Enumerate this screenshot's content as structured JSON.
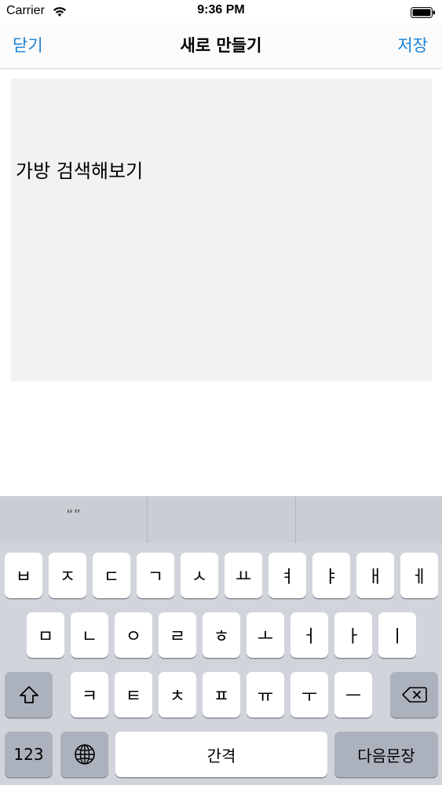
{
  "status_bar": {
    "carrier": "Carrier",
    "time": "9:36 PM"
  },
  "nav": {
    "close_label": "닫기",
    "title": "새로 만들기",
    "save_label": "저장"
  },
  "editor": {
    "text": "가방 검색해보기"
  },
  "keyboard": {
    "suggestions": [
      "“”",
      "",
      ""
    ],
    "row1": [
      "ㅂ",
      "ㅈ",
      "ㄷ",
      "ㄱ",
      "ㅅ",
      "ㅛ",
      "ㅕ",
      "ㅑ",
      "ㅐ",
      "ㅔ"
    ],
    "row2": [
      "ㅁ",
      "ㄴ",
      "ㅇ",
      "ㄹ",
      "ㅎ",
      "ㅗ",
      "ㅓ",
      "ㅏ",
      "ㅣ"
    ],
    "row3": [
      "ㅋ",
      "ㅌ",
      "ㅊ",
      "ㅍ",
      "ㅠ",
      "ㅜ",
      "ㅡ"
    ],
    "numbers_label": "123",
    "space_label": "간격",
    "return_label": "다음문장"
  },
  "icons": {
    "wifi": "wifi-icon",
    "battery": "battery-icon",
    "shift": "shift-icon",
    "delete": "delete-icon",
    "globe": "globe-icon"
  },
  "colors": {
    "accent": "#1a82d6",
    "editor_bg": "#f2f2f4",
    "keyboard_bg": "#d1d5db"
  }
}
